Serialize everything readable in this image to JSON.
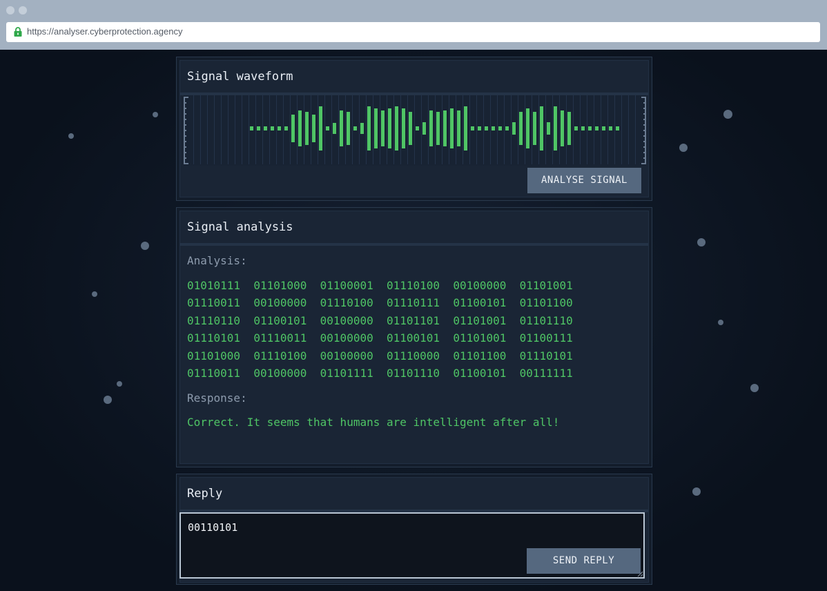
{
  "browser": {
    "url": "https://analyser.cyberprotection.agency"
  },
  "waveform_panel": {
    "title": "Signal waveform",
    "analyse_button": "ANALYSE SIGNAL",
    "bar_color": "#4fc565",
    "bar_levels": [
      0.09,
      0.09,
      0.09,
      0.09,
      0.09,
      0.09,
      0.57,
      0.74,
      0.68,
      0.57,
      0.91,
      0.09,
      0.23,
      0.74,
      0.68,
      0.09,
      0.23,
      0.91,
      0.83,
      0.74,
      0.83,
      0.91,
      0.83,
      0.68,
      0.09,
      0.25,
      0.74,
      0.68,
      0.74,
      0.83,
      0.74,
      0.91,
      0.09,
      0.09,
      0.09,
      0.09,
      0.09,
      0.09,
      0.25,
      0.68,
      0.83,
      0.68,
      0.91,
      0.25,
      0.91,
      0.74,
      0.68,
      0.09,
      0.09,
      0.09,
      0.09,
      0.09,
      0.09,
      0.09
    ]
  },
  "analysis_panel": {
    "title": "Signal analysis",
    "analysis_label": "Analysis:",
    "binary_rows": [
      "01010111  01101000  01100001  01110100  00100000  01101001",
      "01110011  00100000  01110100  01110111  01100101  01101100",
      "01110110  01100101  00100000  01101101  01101001  01101110",
      "01110101  01110011  00100000  01100101  01101001  01100111",
      "01101000  01110100  00100000  01110000  01101100  01110101",
      "01110011  00100000  01101111  01101110  01100101  00111111"
    ],
    "response_label": "Response:",
    "response_text": "Correct. It seems that humans are intelligent after all!"
  },
  "reply_panel": {
    "title": "Reply",
    "reply_value": "00110101",
    "send_button": "SEND REPLY"
  },
  "colors": {
    "accent_green": "#4fc565",
    "button": "#55687f",
    "panel": "#1a2535",
    "background": "#0b1320"
  }
}
